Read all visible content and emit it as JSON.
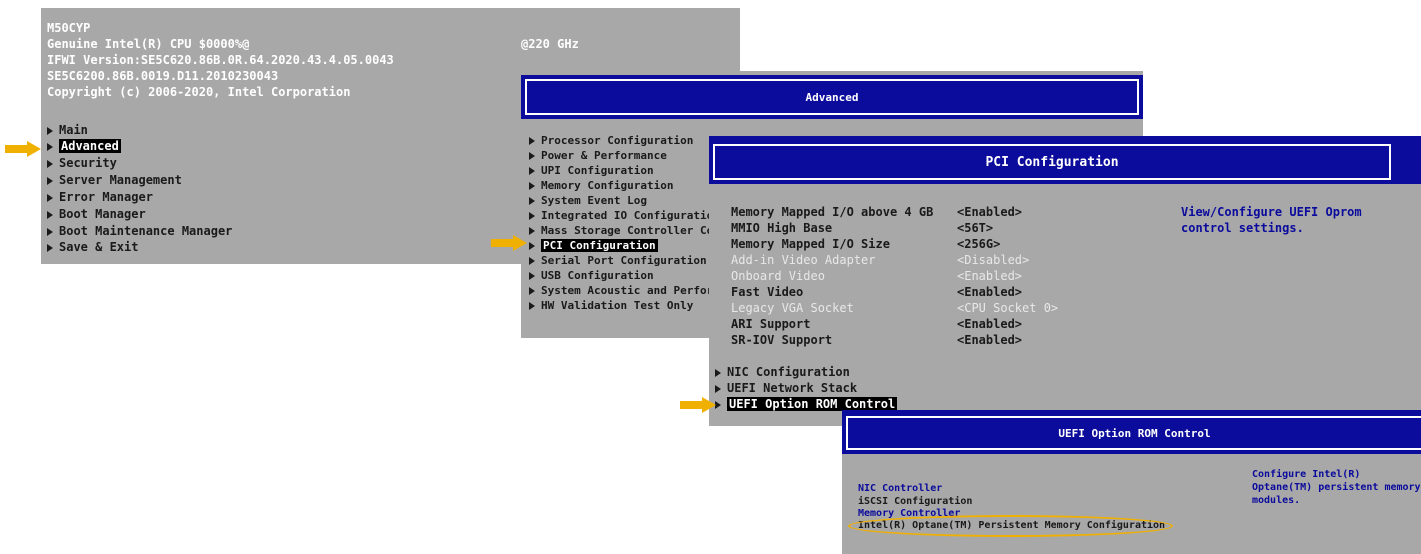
{
  "colors": {
    "screen_bg": "#a8a8a8",
    "title_blue": "#0c0c9c",
    "highlight_arrow": "#f0b000",
    "menu_text_blue": "#0a0a9c"
  },
  "screen1": {
    "header": [
      "M50CYP",
      "Genuine Intel(R) CPU $0000%@",
      "IFWI Version:SE5C620.86B.0R.64.2020.43.4.05.0043",
      "SE5C6200.86B.0019.D11.2010230043",
      "Copyright (c) 2006-2020, Intel Corporation"
    ],
    "freq": "@220 GHz",
    "menu": [
      "Main",
      "Advanced",
      "Security",
      "Server Management",
      "Error Manager",
      "Boot Manager",
      "Boot Maintenance Manager",
      "Save & Exit"
    ],
    "selected": "Advanced"
  },
  "screen2": {
    "title": "Advanced",
    "menu": [
      "Processor Configuration",
      "Power & Performance",
      "UPI Configuration",
      "Memory Configuration",
      "System Event Log",
      "Integrated IO Configuration",
      "Mass Storage Controller Con",
      "PCI Configuration",
      "Serial Port Configuration",
      "USB Configuration",
      "System Acoustic and Perform",
      "HW Validation Test Only"
    ],
    "selected": "PCI Configuration"
  },
  "screen3": {
    "title": "PCI Configuration",
    "settings": [
      {
        "label": "Memory Mapped I/O above 4 GB",
        "value": "<Enabled>",
        "enabled": true
      },
      {
        "label": "MMIO High Base",
        "value": "<56T>",
        "enabled": true
      },
      {
        "label": "Memory Mapped I/O Size",
        "value": "<256G>",
        "enabled": true
      },
      {
        "label": "Add-in Video Adapter",
        "value": "<Disabled>",
        "enabled": false
      },
      {
        "label": "Onboard Video",
        "value": "<Enabled>",
        "enabled": false
      },
      {
        "label": "Fast Video",
        "value": "<Enabled>",
        "enabled": true
      },
      {
        "label": "Legacy VGA Socket",
        "value": "<CPU Socket 0>",
        "enabled": false
      },
      {
        "label": "ARI Support",
        "value": "<Enabled>",
        "enabled": true
      },
      {
        "label": "SR-IOV Support",
        "value": "<Enabled>",
        "enabled": true
      }
    ],
    "help": [
      "View/Configure UEFI Oprom",
      "control settings."
    ],
    "submenus": [
      "NIC Configuration",
      "UEFI Network Stack",
      "UEFI Option ROM Control"
    ],
    "selected": "UEFI Option ROM Control"
  },
  "screen4": {
    "title": "UEFI Option ROM Control",
    "items": [
      "NIC Controller",
      "iSCSI Configuration",
      "Memory Controller",
      "Intel(R) Optane(TM) Persistent Memory Configuration"
    ],
    "help": [
      "Configure Intel(R)",
      "Optane(TM) persistent memory",
      "modules."
    ]
  }
}
